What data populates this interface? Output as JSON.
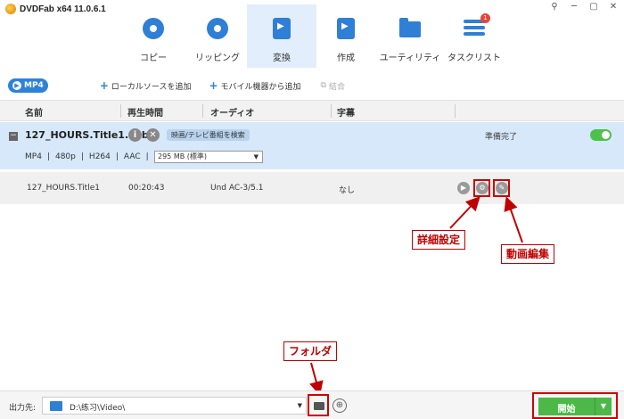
{
  "app": {
    "brand": "DVDFab x64  11.0.6.1"
  },
  "window_controls": [
    "⚲",
    "─",
    "▢",
    "✕"
  ],
  "toolbar": [
    {
      "label": "コピー",
      "icon": "copy-disc-icon"
    },
    {
      "label": "リッピング",
      "icon": "ripper-disc-icon"
    },
    {
      "label": "変換",
      "icon": "converter-icon",
      "active": true
    },
    {
      "label": "作成",
      "icon": "creator-icon"
    },
    {
      "label": "ユーティリティ",
      "icon": "utility-folder-icon"
    },
    {
      "label": "タスクリスト",
      "icon": "task-list-icon",
      "badge": "1"
    }
  ],
  "subbar": {
    "profile": "MP4",
    "add_local": "ローカルソースを追加",
    "add_mobile": "モバイル機器から追加",
    "merge": "結合"
  },
  "table": {
    "columns": [
      "名前",
      "再生時間",
      "オーディオ",
      "字幕"
    ]
  },
  "title_row": {
    "filename": "127_HOURS.Title1.vob",
    "search_tv": "映画/テレビ番組を検索",
    "status": "準備完了",
    "specs": [
      "MP4",
      "|",
      "480p",
      "|",
      "H264",
      "|",
      "AAC",
      "|"
    ],
    "size": "295 MB (標準)"
  },
  "track_row": {
    "name": "127_HOURS.Title1",
    "duration": "00:20:43",
    "audio": "Und AC-3/5.1",
    "subtitle": "なし"
  },
  "annotations": {
    "advanced": "詳細設定",
    "video_edit": "動画編集",
    "folder": "フォルダ"
  },
  "bottom": {
    "output_label": "出力先:",
    "path": "D:\\练习\\Video\\",
    "start": "開始"
  },
  "colors": {
    "accent": "#2d82d8",
    "selected_row": "#d6e8f9",
    "start_button": "#4cb848",
    "annotation_red": "#c00000"
  }
}
